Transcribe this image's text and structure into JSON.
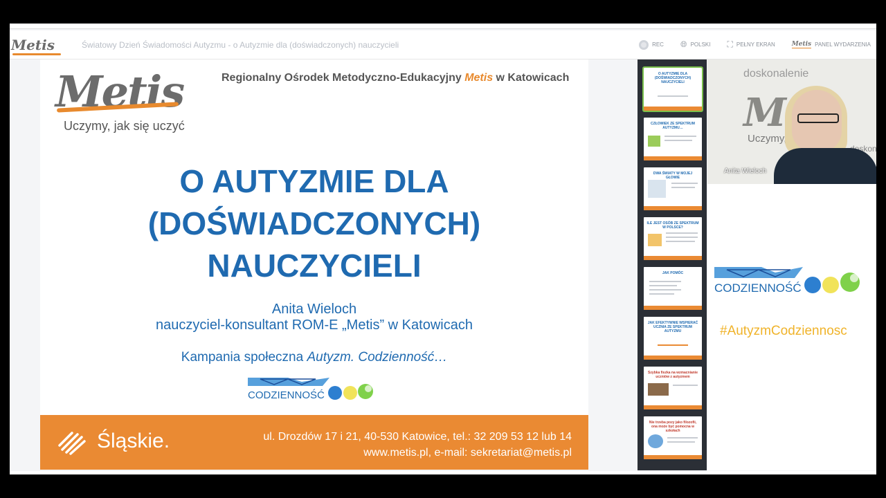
{
  "header": {
    "logo_text": "Metis",
    "title": "Światowy Dzień Świadomości Autyzmu - o Autyzmie dla (doświadczonych) nauczycieli",
    "controls": [
      {
        "icon": "toggle-icon",
        "label": "REC"
      },
      {
        "icon": "globe-icon",
        "label": "POLSKI"
      },
      {
        "icon": "fullscreen-icon",
        "label": "PEŁNY EKRAN"
      },
      {
        "icon": "metis-icon",
        "label": "PANEL WYDARZENIA"
      }
    ]
  },
  "slide": {
    "logo": "Metis",
    "tagline": "Uczymy, jak się uczyć",
    "org_prefix": "Regionalny Ośrodek Metodyczno-Edukacyjny ",
    "org_brand": "Metis",
    "org_suffix": " w Katowicach",
    "title_lines": [
      "O AUTYZMIE DLA",
      "(DOŚWIADCZONYCH)",
      "NAUCZYCIELI"
    ],
    "author_name": "Anita Wieloch",
    "author_role": "nauczyciel-konsultant ROM-E „Metis” w Katowicach",
    "campaign_prefix": "Kampania społeczna ",
    "campaign_em": "Autyzm. Codzienność…",
    "campaign_logo_text": "CODZIENNOŚĆ",
    "footer_brand": "Śląskie.",
    "footer_address": "ul. Drozdów 17 i 21, 40-530 Katowice, tel.: 32 209 53 12 lub 14",
    "footer_contact": "www.metis.pl, e-mail: sekretariat@metis.pl"
  },
  "thumbnails": [
    {
      "title": "O AUTYZMIE DLA (DOŚWIADCZONYCH) NAUCZYCIELI",
      "active": true
    },
    {
      "title": "CZŁOWIEK ZE SPEKTRUM AUTYZMU…",
      "active": false
    },
    {
      "title": "DWA ŚWIATY W MOJEJ GŁOWIE",
      "active": false
    },
    {
      "title": "ILE JEST OSÓB ZE SPEKTRUM W POLSCE?",
      "active": false
    },
    {
      "title": "JAK POMÓC",
      "active": false
    },
    {
      "title": "JAK EFEKTYWNIE WSPIERAĆ UCZNIA ZE SPEKTRUM AUTYZMU",
      "active": false
    },
    {
      "title": "Szybka fiszka na wzmacnianie uczniów z autyzmem",
      "active": false
    },
    {
      "title": "Nie trzeba pozy jako filozofii, ona może być pomocna w szkołach",
      "active": false
    }
  ],
  "video": {
    "participant_name": "Anita Wieloch",
    "bg_words": [
      "doskonalenie",
      "Uczymy, j",
      "doskon"
    ]
  },
  "sidebar": {
    "logo_text": "CODZIENNOŚĆ",
    "hashtag": "#AutyzmCodziennosc"
  },
  "colors": {
    "accent_orange": "#ea8a33",
    "title_blue": "#1f6ab0",
    "hashtag_yellow": "#f0b32a"
  }
}
